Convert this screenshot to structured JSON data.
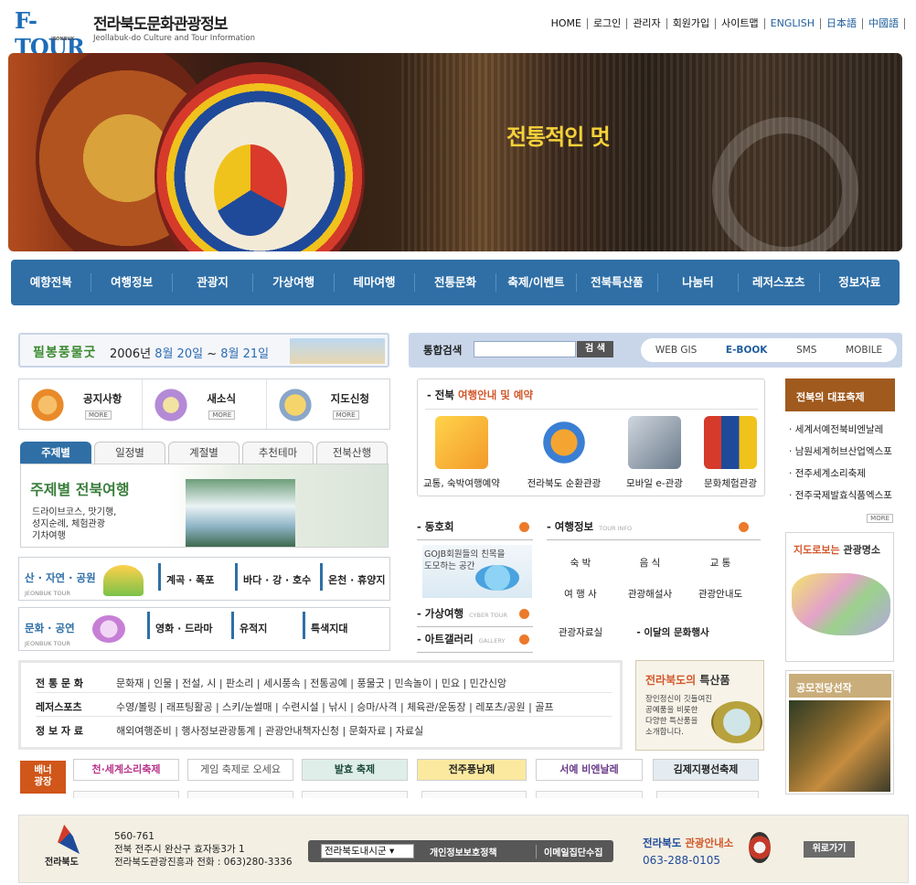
{
  "header": {
    "logo_text": "F-TOUR",
    "logo_sub": "JEONBUK",
    "site_title": "전라북도문화관광정보",
    "site_subtitle": "Jeollabuk-do Culture and Tour Information",
    "top_links": [
      "HOME",
      "로그인",
      "관리자",
      "회원가입",
      "사이트맵",
      "ENGLISH",
      "日本語",
      "中國語"
    ]
  },
  "banner": {
    "caption": "전통적인 멋"
  },
  "main_nav": [
    "예향전북",
    "여행정보",
    "관광지",
    "가상여행",
    "테마여행",
    "전통문화",
    "축제/이벤트",
    "전북특산품",
    "나눔터",
    "레저스포츠",
    "정보자료"
  ],
  "event": {
    "name": "필봉풍물굿",
    "date_prefix": "2006년",
    "date_from": "8월 20일",
    "sep": "~",
    "date_to": "8월 21일"
  },
  "search": {
    "label": "통합검색",
    "placeholder": "",
    "button": "검 색",
    "links": [
      "WEB GIS",
      "E-BOOK",
      "SMS",
      "MOBILE"
    ]
  },
  "notice": {
    "items": [
      "공지사항",
      "새소식",
      "지도신청"
    ],
    "more": "MORE"
  },
  "tabs": [
    "주제별",
    "일정별",
    "계절별",
    "추천테마",
    "전북산행"
  ],
  "tab_panel": {
    "headline": "주제별 전북여행",
    "desc_lines": [
      "드라이브코스, 맛기행,",
      "성지순례, 체험관광",
      "기차여행"
    ]
  },
  "category_nature": {
    "title": "산 · 자연 · 공원",
    "sub": "JEONBUK TOUR",
    "items": [
      "계곡 · 폭포",
      "바다 · 강 · 호수",
      "온천 · 휴양지"
    ]
  },
  "category_culture": {
    "title": "문화 · 공연",
    "sub": "JEONBUK TOUR",
    "items": [
      "영화 · 드라마",
      "유적지",
      "특색지대"
    ]
  },
  "reservation": {
    "title_prefix": "전북",
    "title_highlight": "여행안내 및 예약",
    "items": [
      "교통, 숙박여행예약",
      "전라북도 순환관광",
      "모바일 e-관광",
      "문화체험관광"
    ]
  },
  "club": {
    "title": "동호회",
    "text_lines": [
      "GOJB회원들의 친목을",
      "도모하는 공간"
    ]
  },
  "travel_info": {
    "title": "여행정보",
    "tag": "TOUR INFO",
    "grid": [
      [
        "숙  박",
        "음  식",
        "교  통"
      ],
      [
        "여 행 사",
        "관광해설사",
        "관광안내도"
      ]
    ],
    "extra": "관광자료실",
    "extra2": "이달의 문화행사"
  },
  "virtual_trip": {
    "title": "가상여행",
    "tag": "CYBER TOUR"
  },
  "art_gallery": {
    "title": "아트갤러리",
    "tag": "GALLERY"
  },
  "festivals": {
    "title": "전북의 대표축제",
    "items": [
      "세계서예전북비엔날레",
      "남원세계허브산업엑스포",
      "전주세계소리축제",
      "전주국제발효식품엑스포"
    ],
    "more": "MORE"
  },
  "map_box": {
    "highlight": "지도로보는",
    "title": "관광명소"
  },
  "contest": {
    "title": "공모전당선작"
  },
  "keywords": [
    {
      "label": "전 통 문 화",
      "values": "문화재 | 인물 | 전설, 시 | 판소리 | 세시풍속 | 전통공예 | 풍물굿 | 민속놀이 | 민요 | 민간신앙"
    },
    {
      "label": "레저스포츠",
      "values": "수영/볼링 | 래프팅활공 | 스키/눈썰매 | 수련시설 | 낚시 | 승마/사격 | 체육관/운동장 | 레포츠/공원 | 골프"
    },
    {
      "label": "정 보 자 료",
      "values": "해외여행준비 | 행사정보관광통계 | 관광안내책자신청 | 문화자료 | 자료실"
    }
  ],
  "special_products": {
    "title_highlight": "전라북도의",
    "title": "특산품",
    "desc_lines": [
      "장인정신이 깃들여진",
      "공예품을 비롯한",
      "다양한 특산품을",
      "소개합니다."
    ]
  },
  "banner_plaza": {
    "label_lines": [
      "배너",
      "광장"
    ],
    "banners": [
      "천·세계소리축제",
      "게임 축제로 오세요",
      "발효 축제",
      "전주풍남제",
      "서예 비엔날레",
      "김제지평선축제"
    ]
  },
  "footer": {
    "logo_text": "전라북도",
    "logo_sub": "JEOLLABUK-DO",
    "address_lines": [
      "560-761",
      "전북 전주시 완산구 효자동3가 1",
      "전라북도관광진흥과 전화 : 063)280-3336"
    ],
    "select_value": "전라북도내시군",
    "privacy": "개인정보보호정책",
    "email_policy": "이메일집단수집",
    "info_prefix": "전라북도",
    "info_title": "관광안내소",
    "phone": "063-288-0105",
    "top_button": "위로가기"
  },
  "colors": {
    "nav": "#2f6fa6",
    "accent": "#d2572b",
    "festival": "#a05a1d"
  }
}
